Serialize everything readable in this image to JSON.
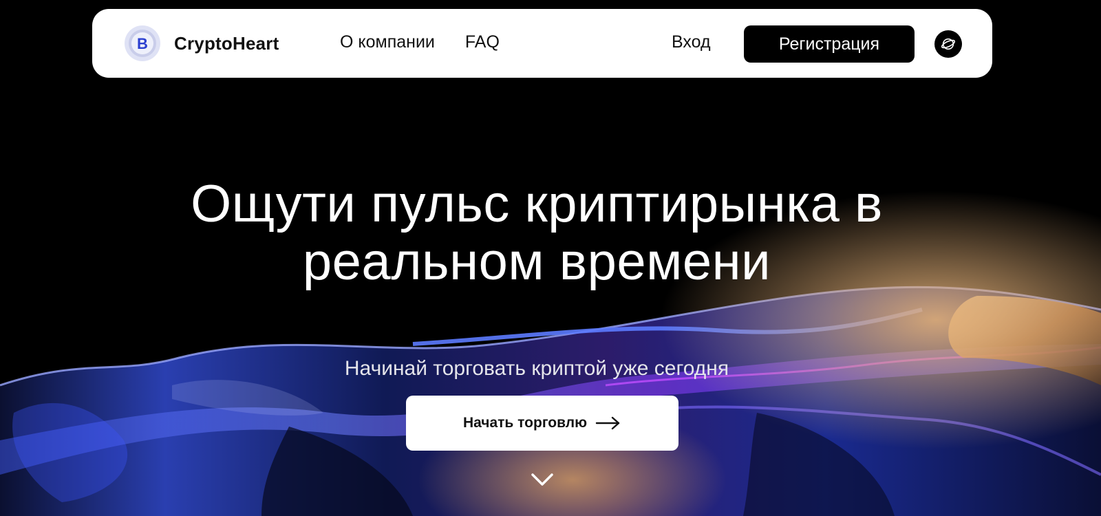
{
  "header": {
    "logo_text": "CryptoHeart",
    "logo_letter": "B",
    "nav": [
      {
        "label": "О компании"
      },
      {
        "label": "FAQ"
      }
    ],
    "login_label": "Вход",
    "register_label": "Регистрация",
    "language_icon": "globe-icon"
  },
  "hero": {
    "title": "Ощути пульс криптирынка в реальном времени",
    "subtitle": "Начинай торговать криптой уже сегодня",
    "cta_label": "Начать торговлю",
    "cta_icon": "arrow-right-icon",
    "scroll_icon": "chevron-down-icon"
  },
  "colors": {
    "background": "#000000",
    "navbar": "#ffffff",
    "button_dark": "#000000",
    "button_light": "#ffffff",
    "accent_blue": "#3b4cff",
    "accent_violet": "#a04cff",
    "accent_gold": "#d9a15a"
  }
}
